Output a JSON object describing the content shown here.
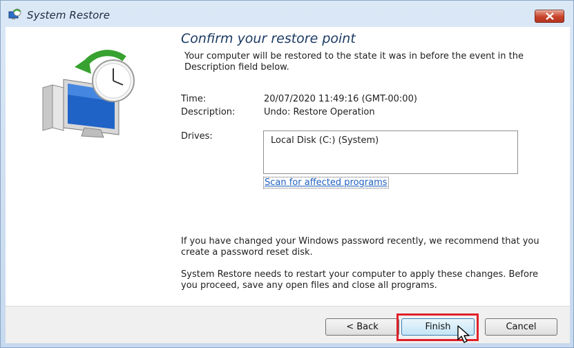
{
  "window": {
    "title": "System Restore"
  },
  "icons": {
    "app": "system-restore-icon",
    "close": "close-icon",
    "hero": "restore-monitor-clock-icon",
    "cursor": "mouse-pointer-icon"
  },
  "content": {
    "heading": "Confirm your restore point",
    "intro": "Your computer will be restored to the state it was in before the event in the Description field below.",
    "time_label": "Time:",
    "time_value": "20/07/2020 11:49:16 (GMT-00:00)",
    "description_label": "Description:",
    "description_value": "Undo: Restore Operation",
    "drives_label": "Drives:",
    "drives": [
      "Local Disk (C:) (System)"
    ],
    "scan_link": "Scan for affected programs",
    "password_note": "If you have changed your Windows password recently, we recommend that you create a password reset disk.",
    "restart_note": "System Restore needs to restart your computer to apply these changes. Before you proceed, save any open files and close all programs."
  },
  "buttons": {
    "back": "< Back",
    "finish": "Finish",
    "cancel": "Cancel"
  },
  "colors": {
    "highlight": "#e0202a",
    "heading": "#1c3b63",
    "link": "#1f5fbf"
  }
}
